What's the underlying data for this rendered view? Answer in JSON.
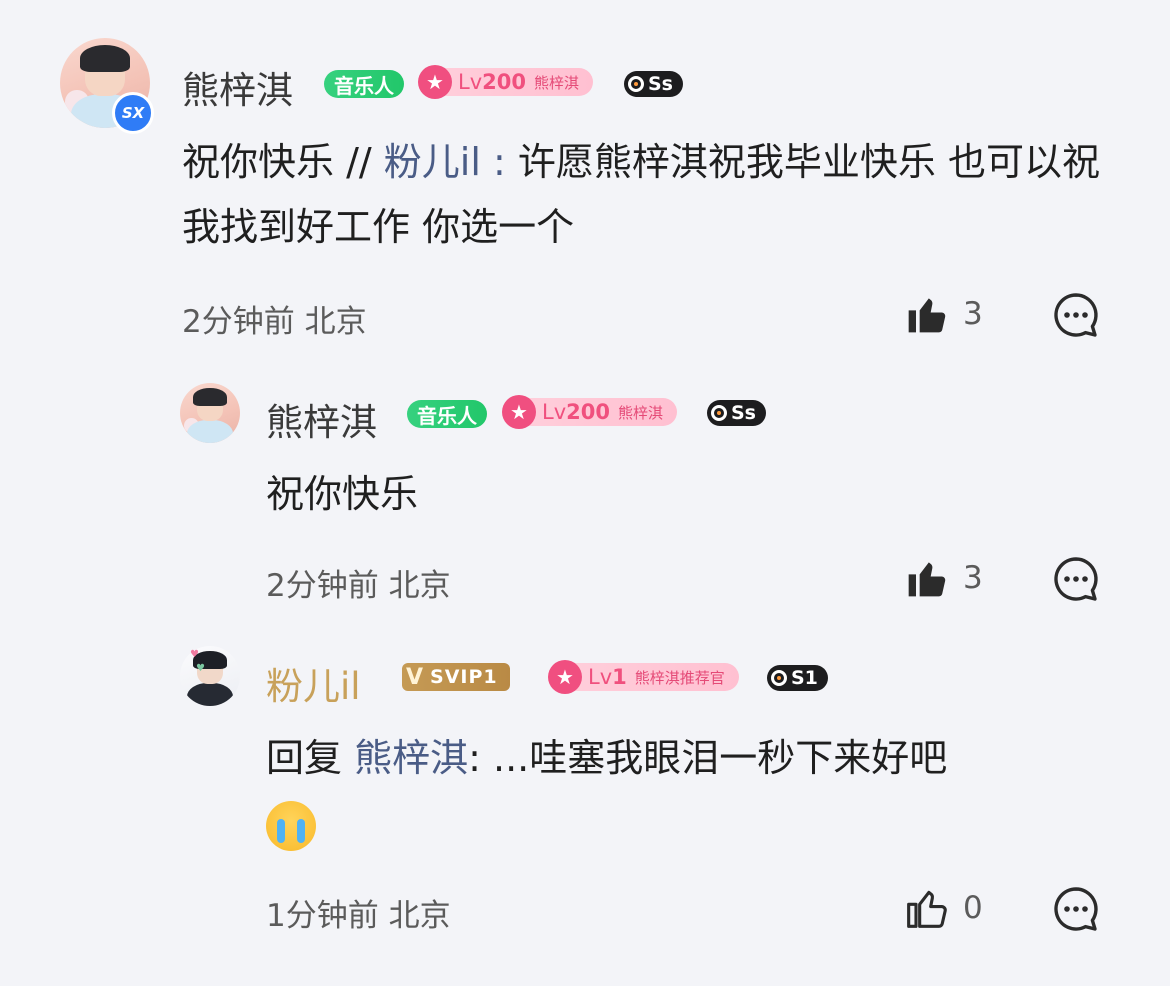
{
  "comments": [
    {
      "name": "熊梓淇",
      "badge_music": "音乐人",
      "badge_level_prefix": "Lv",
      "badge_level_num": "200",
      "badge_level_fan": "熊梓淇",
      "badge_ss": "Ss",
      "verify_mark": "SX",
      "text_prefix": "祝你快乐 // ",
      "text_quote_name": "粉儿il",
      "text_quote_sep": " : ",
      "text_body": "许愿熊梓淇祝我毕业快乐 也可以祝我找到好工作 你选一个",
      "time": "2分钟前",
      "location": "北京",
      "likes": "3"
    },
    {
      "name": "熊梓淇",
      "badge_music": "音乐人",
      "badge_level_prefix": "Lv",
      "badge_level_num": "200",
      "badge_level_fan": "熊梓淇",
      "badge_ss": "Ss",
      "text": "祝你快乐",
      "time": "2分钟前",
      "location": "北京",
      "likes": "3"
    },
    {
      "name": "粉儿il",
      "badge_svip": "SVIP1",
      "badge_level_prefix": "Lv",
      "badge_level_num": "1",
      "badge_level_fan": "熊梓淇推荐官",
      "badge_ss": "S1",
      "text_prefix": "回复 ",
      "text_reply_name": "熊梓淇",
      "text_body": ": ...哇塞我眼泪一秒下来好吧",
      "emoji": "loudly-crying-face",
      "time": "1分钟前",
      "location": "北京",
      "likes": "0"
    }
  ],
  "colors": {
    "background": "#f3f4f8",
    "music_badge": "#22c76a",
    "level_badge": "#f04f80",
    "svip_gold": "#c59a55",
    "quote_name": "#4a5c86",
    "vip_name": "#c8a15a"
  },
  "icons": [
    "thumbs-up-filled-icon",
    "thumbs-up-outline-icon",
    "comment-bubble-icon",
    "verified-badge-icon",
    "star-icon"
  ]
}
